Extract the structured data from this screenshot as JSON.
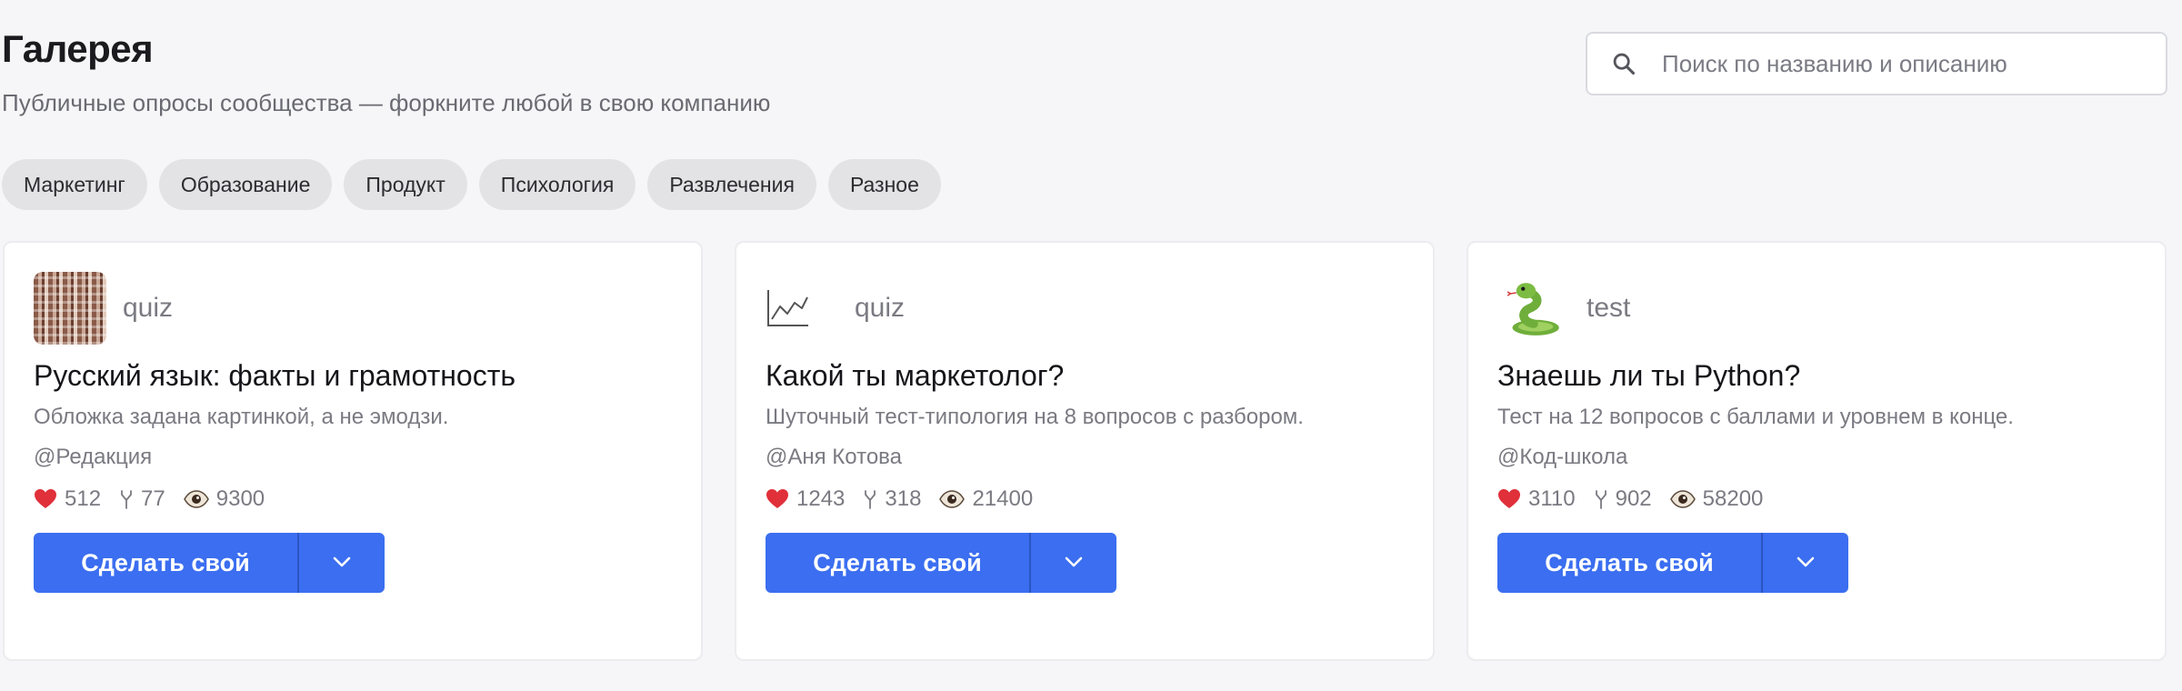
{
  "header": {
    "title": "Галерея",
    "subtitle": "Публичные опросы сообщества — форкните любой в свою компанию"
  },
  "search": {
    "placeholder": "Поиск по названию и описанию",
    "value": ""
  },
  "categories": [
    "Маркетинг",
    "Образование",
    "Продукт",
    "Психология",
    "Развлечения",
    "Разное"
  ],
  "cards": [
    {
      "cover_icon": "image-cover",
      "type": "quiz",
      "title": "Русский язык: факты и грамотность",
      "description": "Обложка задана картинкой, а не эмодзи.",
      "author": "@Редакция",
      "likes": "512",
      "forks": "77",
      "views": "9300",
      "action_label": "Сделать свой"
    },
    {
      "cover_icon": "chart-line-icon",
      "type": "quiz",
      "title": "Какой ты маркетолог?",
      "description": "Шуточный тест-типология на 8 вопросов с разбором.",
      "author": "@Аня Котова",
      "likes": "1243",
      "forks": "318",
      "views": "21400",
      "action_label": "Сделать свой"
    },
    {
      "cover_icon": "snake-emoji",
      "type": "test",
      "title": "Знаешь ли ты Python?",
      "description": "Тест на 12 вопросов с баллами и уровнем в конце.",
      "author": "@Код-школа",
      "likes": "3110",
      "forks": "902",
      "views": "58200",
      "action_label": "Сделать свой"
    }
  ],
  "colors": {
    "accent": "#3b6ef0",
    "background": "#f6f6f8",
    "chip": "#e3e3e6",
    "heart": "#e0303a"
  }
}
